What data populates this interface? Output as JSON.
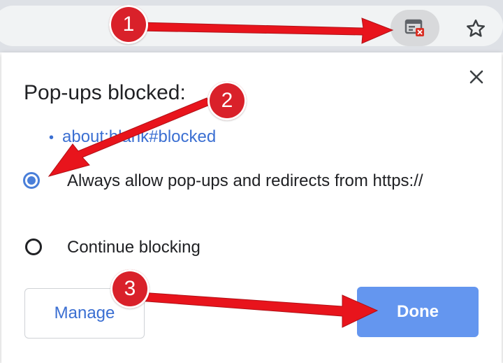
{
  "browser": {
    "popup_blocked_icon": "popup-blocked-icon",
    "bookmark_icon": "star-icon"
  },
  "dialog": {
    "title": "Pop-ups blocked:",
    "blocked_links": [
      {
        "label": "about:blank#blocked"
      }
    ],
    "options": [
      {
        "label": "Always allow pop-ups and redirects from https://",
        "selected": true
      },
      {
        "label": "Continue blocking",
        "selected": false
      }
    ],
    "manage_label": "Manage",
    "done_label": "Done",
    "close_icon": "close-icon"
  },
  "annotations": {
    "step_1": "1",
    "step_2": "2",
    "step_3": "3",
    "arrow_color": "#e8141c"
  },
  "colors": {
    "link": "#3b6fd2",
    "done_button": "#6496ef",
    "radio_checked": "#4a7fd9"
  }
}
